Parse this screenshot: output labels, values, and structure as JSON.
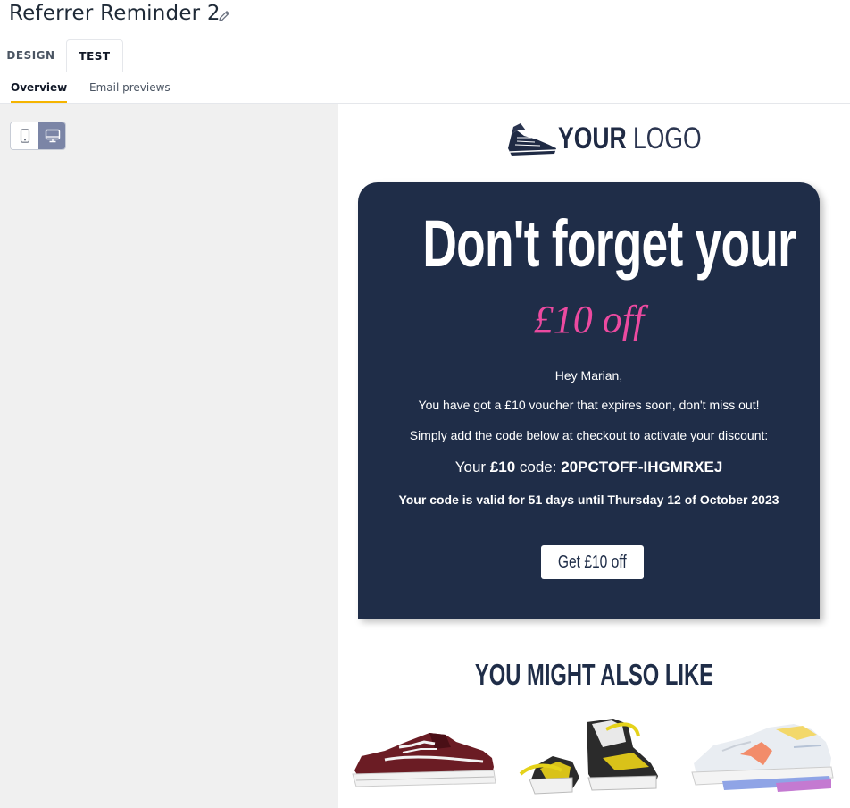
{
  "header": {
    "title": "Referrer Reminder 2"
  },
  "tabs": [
    {
      "label": "DESIGN"
    },
    {
      "label": "TEST"
    }
  ],
  "subtabs": [
    {
      "label": "Overview"
    },
    {
      "label": "Email previews"
    }
  ],
  "device_toggle": {
    "options": [
      "mobile-icon",
      "desktop-icon"
    ],
    "selected": "desktop"
  },
  "email": {
    "logo": {
      "bold": "YOUR",
      "thin": "LOGO"
    },
    "headline": "Don't forget your",
    "amount": "£10 off",
    "greeting": "Hey Marian,",
    "line1": "You have got a £10 voucher that expires soon, don't miss out!",
    "line2": "Simply add the code below at checkout to activate your discount:",
    "code_prefix": "Your ",
    "code_amount": "£10",
    "code_mid": " code: ",
    "code_value": "20PCTOFF-IHGMRXEJ",
    "validity": "Your code is valid for 51 days until Thursday 12 of October 2023",
    "cta_label": "Get £10 off",
    "recommend_title": "YOU MIGHT ALSO LIKE"
  },
  "colors": {
    "card_bg": "#1f2d48",
    "accent_pink": "#ec4aa0",
    "tab_underline": "#f5b400",
    "toggle_active": "#7b85a6"
  }
}
